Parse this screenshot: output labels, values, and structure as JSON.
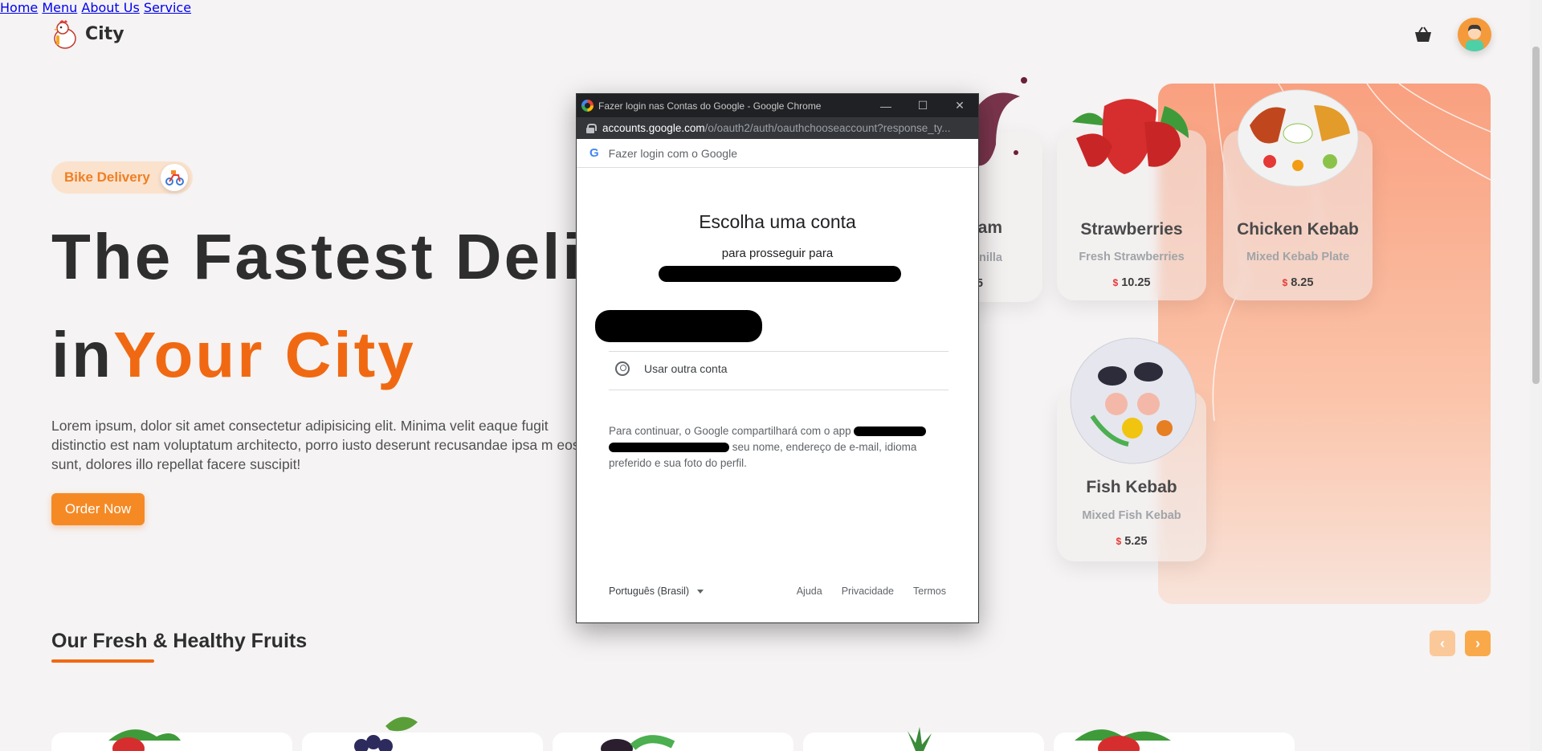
{
  "header": {
    "brand": "City",
    "nav": [
      "Home",
      "Menu",
      "About Us",
      "Service"
    ]
  },
  "hero": {
    "badge": "Bike Delivery",
    "title_line1": "The Fastest Deliv",
    "title_in": "in",
    "title_highlight": "Your City",
    "description": "Lorem ipsum, dolor sit amet consectetur adipisicing elit. Minima velit eaque fugit distinctio est nam voluptatum architecto, porro iusto deserunt recusandae ipsa m eos sunt, dolores illo repellat facere suscipit!",
    "order_button": "Order Now"
  },
  "cards": [
    {
      "name": "am",
      "sub": "& vanilla",
      "price": "5",
      "currency": ""
    },
    {
      "name": "Strawberries",
      "sub": "Fresh Strawberries",
      "price": "10.25",
      "currency": "$"
    },
    {
      "name": "Chicken Kebab",
      "sub": "Mixed Kebab Plate",
      "price": "8.25",
      "currency": "$"
    },
    {
      "name": "Fish Kebab",
      "sub": "Mixed Fish Kebab",
      "price": "5.25",
      "currency": "$"
    }
  ],
  "section": {
    "title": "Our Fresh & Healthy Fruits",
    "prev": "‹",
    "next": "›"
  },
  "popup": {
    "window_title": "Fazer login nas Contas do Google - Google Chrome",
    "url_host": "accounts.google.com",
    "url_path": "/o/oauth2/auth/oauthchooseaccount?response_ty...",
    "signin_header": "Fazer login com o Google",
    "g_mark": "G",
    "choose_title": "Escolha uma conta",
    "choose_sub": "para prosseguir para",
    "use_other": "Usar outra conta",
    "consent_start": "Para continuar, o Google compartilhará com o app",
    "consent_end": "seu nome, endereço de e-mail, idioma preferido e sua foto do perfil.",
    "language": "Português (Brasil)",
    "links": [
      "Ajuda",
      "Privacidade",
      "Termos"
    ]
  },
  "colors": {
    "accent": "#f06912",
    "button": "#f58a25",
    "arrow_prev": "#fbc89a",
    "arrow_next": "#f9a94a"
  }
}
